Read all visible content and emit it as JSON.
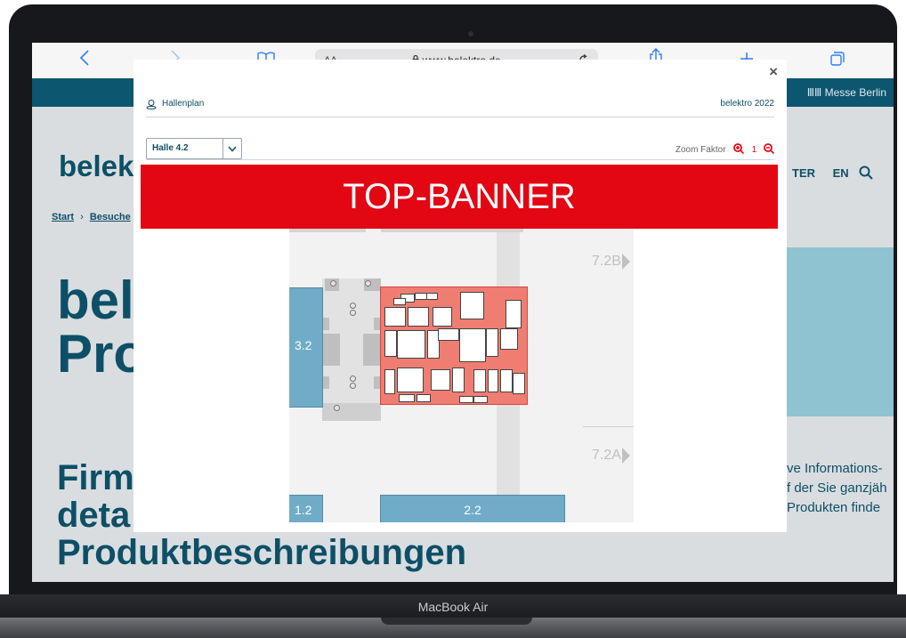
{
  "device": {
    "label": "MacBook Air"
  },
  "browser": {
    "back_icon": "chevron-left-icon",
    "forward_icon": "chevron-right-icon",
    "aa_label": "AA",
    "url": "www.belektro.de",
    "lock_icon": "lock-icon"
  },
  "site": {
    "partner": "Messe Berlin",
    "logo_partial": "belek",
    "nav_lang": "EN",
    "nav_partial": "TER",
    "breadcrumb_start": "Start",
    "breadcrumb_next": "Besuche",
    "heading_line1": "bel",
    "heading_line2": "Pro",
    "sub_line1": "Firm",
    "sub_line2": "deta",
    "sub_line3": "Produktbeschreibungen",
    "side_line1": "ve Informations-",
    "side_line2": "f der Sie ganzjäh",
    "side_line3": "Produkten finde"
  },
  "modal": {
    "close_label": "×",
    "plan_title": "Hallenplan",
    "event_label": "belektro 2022",
    "hall_select": "Halle 4.2",
    "zoom_label": "Zoom Faktor",
    "zoom_value": "1",
    "banner_text": "TOP-BANNER"
  },
  "floorplan": {
    "hall_32": "3.2",
    "hall_12": "1.2",
    "hall_22": "2.2",
    "exit_72b": "7.2B",
    "exit_72a": "7.2A"
  },
  "colors": {
    "brand": "#0d4f66",
    "banner": "#e30613",
    "hall_blue": "#70acc8",
    "hall_red": "#ef7d72",
    "safari_blue": "#2f7df6"
  }
}
